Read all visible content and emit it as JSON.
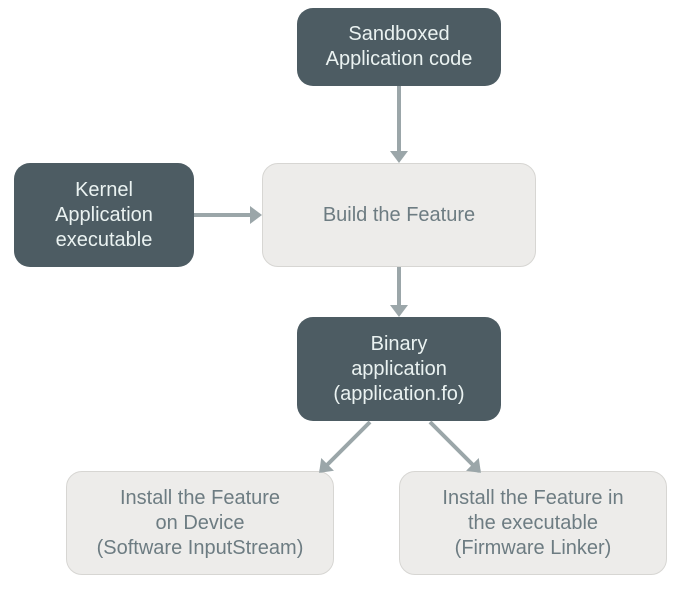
{
  "chart_data": {
    "type": "flowchart",
    "nodes": [
      {
        "id": "sandboxed",
        "label": "Sandboxed\nApplication code",
        "style": "dark"
      },
      {
        "id": "kernel",
        "label": "Kernel\nApplication\nexecutable",
        "style": "dark"
      },
      {
        "id": "build",
        "label": "Build the Feature",
        "style": "light"
      },
      {
        "id": "binary",
        "label": "Binary\napplication\n(application.fo)",
        "style": "dark"
      },
      {
        "id": "install_dev",
        "label": "Install the Feature\non Device\n(Software InputStream)",
        "style": "light"
      },
      {
        "id": "install_exe",
        "label": "Install the Feature in\nthe executable\n(Firmware Linker)",
        "style": "light"
      }
    ],
    "edges": [
      {
        "from": "sandboxed",
        "to": "build"
      },
      {
        "from": "kernel",
        "to": "build"
      },
      {
        "from": "build",
        "to": "binary"
      },
      {
        "from": "binary",
        "to": "install_dev"
      },
      {
        "from": "binary",
        "to": "install_exe"
      }
    ]
  },
  "colors": {
    "dark_node_bg": "#4d5c63",
    "dark_node_text": "#eaf2f1",
    "light_node_bg": "#edecea",
    "light_node_text": "#6d7c82",
    "arrow": "#9ba6a9"
  }
}
